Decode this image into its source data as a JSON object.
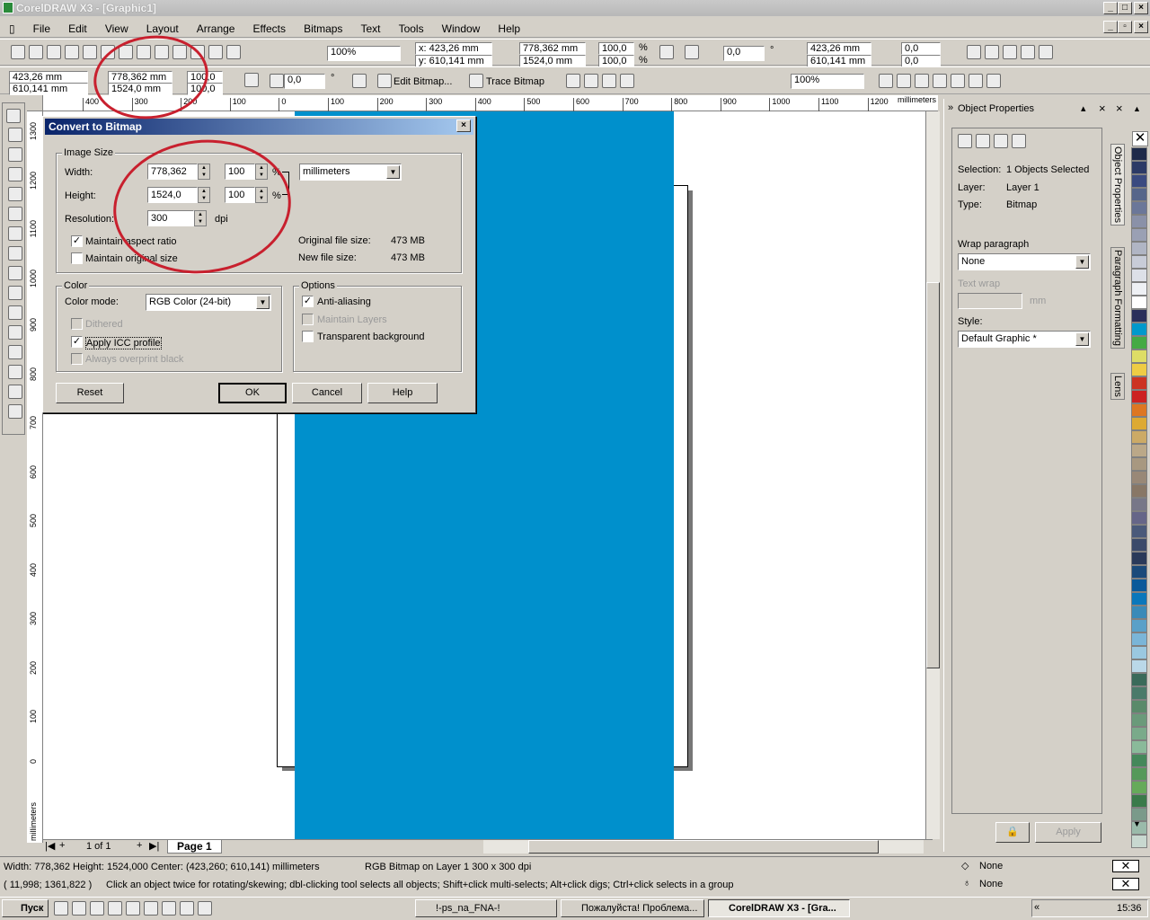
{
  "window": {
    "title": "CorelDRAW X3 - [Graphic1]"
  },
  "menu": [
    "File",
    "Edit",
    "View",
    "Layout",
    "Arrange",
    "Effects",
    "Bitmaps",
    "Text",
    "Tools",
    "Window",
    "Help"
  ],
  "toolbar": {
    "zoom1": "100%",
    "x": "x: 423,26 mm",
    "y": "y: 610,141 mm",
    "w": "778,362 mm",
    "h": "1524,0 mm",
    "sx": "100,0",
    "sy": "100,0",
    "pct": "%",
    "angle": "0,0",
    "deg": "°",
    "x2": "423,26 mm",
    "y2": "610,141 mm",
    "skew1": "0,0",
    "skew2": "0,0"
  },
  "propbar": {
    "x": "423,26 mm",
    "y": "610,141 mm",
    "w": "778,362 mm",
    "h": "1524,0 mm",
    "sx": "100,0",
    "sy": "100,0",
    "angle": "0,0",
    "edit_bitmap": "Edit Bitmap...",
    "trace_bitmap": "Trace Bitmap",
    "zoom": "100%"
  },
  "ruler": {
    "h_ticks": [
      "400",
      "300",
      "200",
      "100",
      "0",
      "100",
      "200",
      "300",
      "400",
      "500",
      "600",
      "700",
      "800",
      "900",
      "1000",
      "1100",
      "1200"
    ],
    "units": "millimeters",
    "v_ticks": [
      "1300",
      "1200",
      "1100",
      "1000",
      "900",
      "800",
      "700",
      "600",
      "500",
      "400",
      "300",
      "200",
      "100",
      "0"
    ],
    "v_units": "millimeters"
  },
  "dialog": {
    "title": "Convert to Bitmap",
    "image_size": "Image Size",
    "width_label": "Width:",
    "width_value": "778,362",
    "width_pct": "100",
    "height_label": "Height:",
    "height_value": "1524,0",
    "height_pct": "100",
    "pct_sign": "%",
    "units": "millimeters",
    "resolution_label": "Resolution:",
    "resolution_value": "300",
    "dpi": "dpi",
    "maintain_aspect": "Maintain aspect ratio",
    "maintain_original": "Maintain original size",
    "orig_size_label": "Original file size:",
    "orig_size_value": "473 MB",
    "new_size_label": "New file size:",
    "new_size_value": "473 MB",
    "color_group": "Color",
    "color_mode_label": "Color mode:",
    "color_mode_value": "RGB Color (24-bit)",
    "dithered": "Dithered",
    "apply_icc": "Apply ICC profile",
    "always_overprint": "Always overprint black",
    "options_group": "Options",
    "anti_aliasing": "Anti-aliasing",
    "maintain_layers": "Maintain Layers",
    "transparent_bg": "Transparent background",
    "reset": "Reset",
    "ok": "OK",
    "cancel": "Cancel",
    "help": "Help"
  },
  "page_nav": {
    "counter": "1 of 1",
    "tab": "Page 1"
  },
  "docker": {
    "title": "Object Properties",
    "selection_label": "Selection:",
    "selection_value": "1 Objects Selected",
    "layer_label": "Layer:",
    "layer_value": "Layer 1",
    "type_label": "Type:",
    "type_value": "Bitmap",
    "wrap_label": "Wrap paragraph",
    "wrap_value": "None",
    "text_wrap": "Text wrap",
    "mm": "mm",
    "style_label": "Style:",
    "style_value": "Default Graphic *",
    "apply": "Apply",
    "tabs": [
      "Object Properties",
      "Paragraph Formatting",
      "Lens"
    ]
  },
  "palette": [
    "#ffffff",
    "#1e2a4a",
    "#2c3a66",
    "#3a4a80",
    "#56668a",
    "#6b7799",
    "#8a91a8",
    "#9aa0b4",
    "#b0b5c4",
    "#c8ccd8",
    "#dde0e8",
    "#eef0f4",
    "#ffffff",
    "#2a2f5a",
    "#0099cc",
    "#44aa44",
    "#dddd66",
    "#eecc44",
    "#cc3322",
    "#cc2222",
    "#dd7722",
    "#ddaa33",
    "#ccaa66",
    "#bba888",
    "#a89880",
    "#998877",
    "#887766",
    "#777788",
    "#666688",
    "#4a5a7a",
    "#3a4a6a",
    "#2a3a5a",
    "#1a4a7a",
    "#0a5a9a",
    "#0a77bb",
    "#3a8ab8",
    "#5aa0c8",
    "#7ab5d8",
    "#9ac8e0",
    "#bad8e8",
    "#3a6a5a",
    "#4a7a6a",
    "#5a8a6a",
    "#6a9a7a",
    "#7aaa8a",
    "#8aba9a",
    "#44885a",
    "#55995a",
    "#66aa5a",
    "#3a7a4a",
    "#7a9a8a",
    "#9abaaa",
    "#c8d8d0"
  ],
  "status": {
    "line1": "Width: 778,362  Height: 1524,000  Center: (423,260; 610,141)  millimeters",
    "line1b": "RGB Bitmap on Layer 1 300 x 300 dpi",
    "line2": "( 11,998; 1361,822 )",
    "line2b": "Click an object twice for rotating/skewing; dbl-clicking tool selects all objects; Shift+click multi-selects; Alt+click digs; Ctrl+click selects in a group",
    "fill": "None",
    "outline": "None"
  },
  "taskbar": {
    "start": "Пуск",
    "tasks": [
      "!-ps_na_FNA-!",
      "Пожалуйста! Проблема...",
      "CorelDRAW X3 - [Gra..."
    ],
    "clock": "15:36"
  },
  "colors": {
    "bitmap": "#0090cc",
    "annotation": "#c8202e",
    "dialog_title": "#0a246a"
  }
}
